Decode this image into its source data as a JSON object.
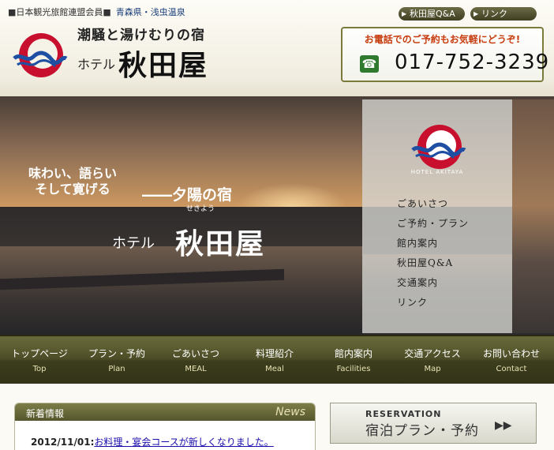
{
  "header": {
    "association": "■日本観光旅館連盟会員■",
    "region": "青森県・浅虫温泉",
    "catchphrase": "潮騒と湯けむりの宿",
    "hotel_prefix": "ホテル",
    "hotel_name": "秋田屋",
    "links": [
      {
        "label": "秋田屋Q&A"
      },
      {
        "label": "リンク"
      }
    ],
    "tel_note": "お電話でのご予約もお気軽にどうぞ!",
    "tel_icon": "phone-icon",
    "tel_number": "017-752-3239"
  },
  "hero": {
    "line1": "味わい、語らい",
    "line2": "そして寛げる",
    "slogan": "――夕陽の宿",
    "ruby": "せきよう",
    "hotel_prefix": "ホテル",
    "hotel_name": "秋田屋",
    "logo_label": "HOTEL AKITAYA",
    "menu": [
      "ごあいさつ",
      "ご予約・プラン",
      "館内案内",
      "秋田屋Q&A",
      "交通案内",
      "リンク"
    ]
  },
  "nav": [
    {
      "ja": "トップページ",
      "en": "Top"
    },
    {
      "ja": "プラン・予約",
      "en": "Plan"
    },
    {
      "ja": "ごあいさつ",
      "en": "MEAL"
    },
    {
      "ja": "料理紹介",
      "en": "Meal"
    },
    {
      "ja": "館内案内",
      "en": "Facilities"
    },
    {
      "ja": "交通アクセス",
      "en": "Map"
    },
    {
      "ja": "お問い合わせ",
      "en": "Contact"
    }
  ],
  "news": {
    "title": "新着情報",
    "title_en": "News",
    "items": [
      {
        "date": "2012/11/01:",
        "text": "お料理・宴会コースが新しくなりました。"
      }
    ]
  },
  "reservation": {
    "en": "RESERVATION",
    "ja": "宿泊プラン・予約",
    "icon": "double-chevron-right-icon"
  },
  "colors": {
    "accent_red": "#c8102e",
    "accent_blue": "#1f4fa3",
    "nav_olive": "#4c4d27"
  }
}
